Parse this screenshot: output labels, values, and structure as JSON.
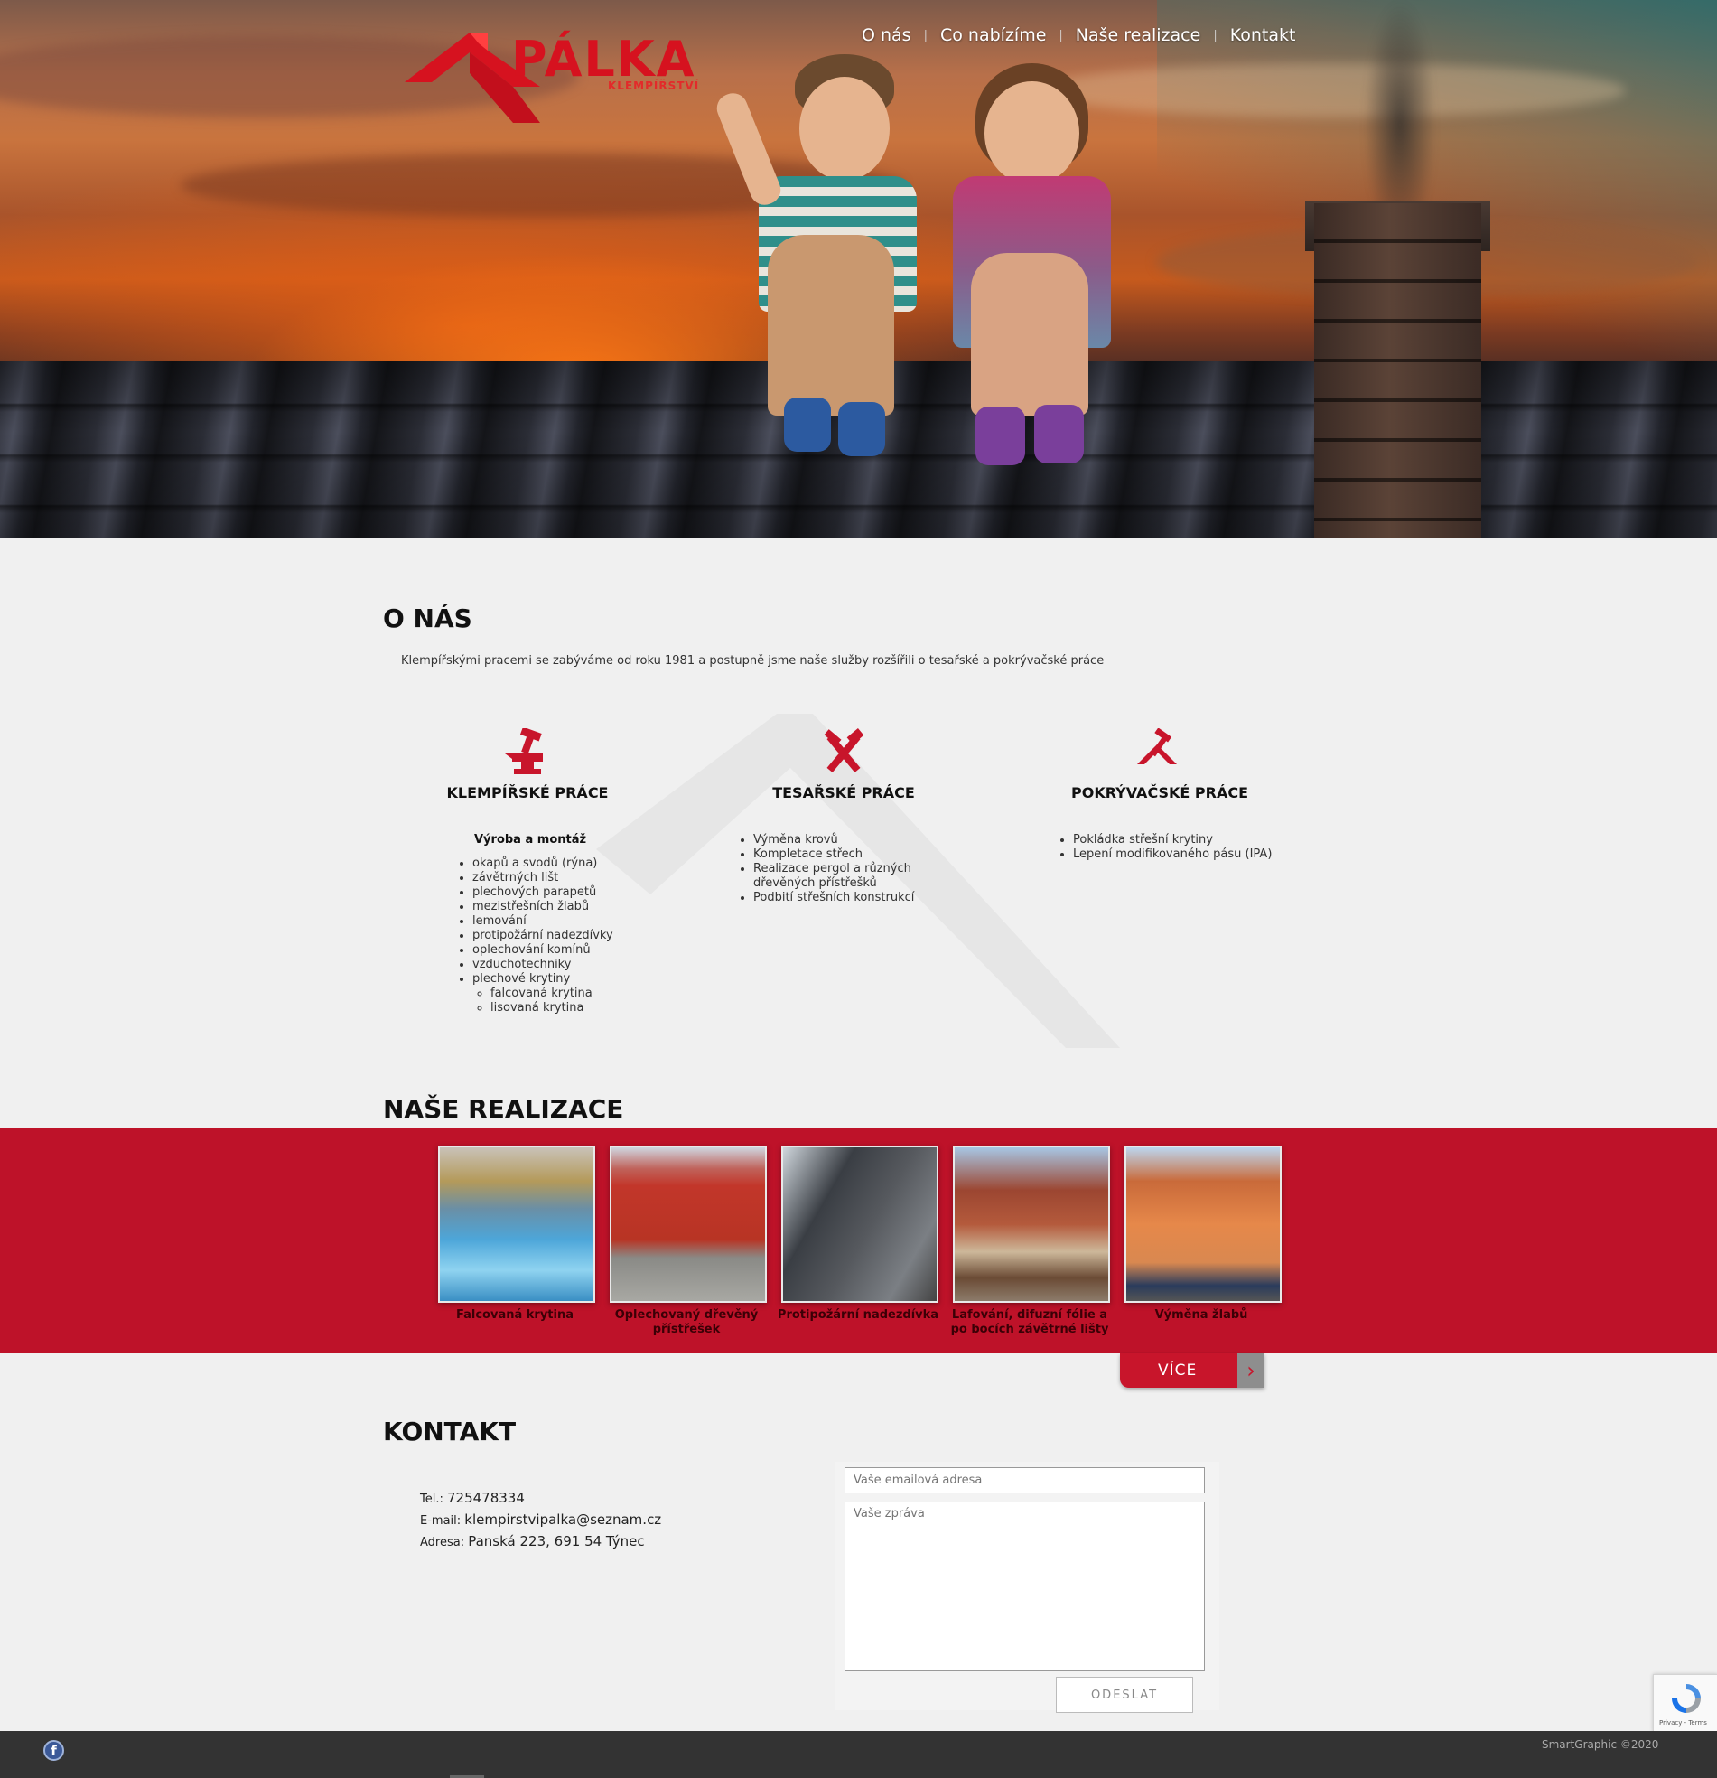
{
  "header": {
    "logo": {
      "brand": "PÁLKA",
      "sub": "KLEMPÍŘSTVÍ"
    },
    "nav": [
      {
        "label": "O nás"
      },
      {
        "label": "Co nabízíme"
      },
      {
        "label": "Naše realizace"
      },
      {
        "label": "Kontakt"
      }
    ]
  },
  "about": {
    "title": "O NÁS",
    "intro": "Klempířskými pracemi se zabýváme od roku 1981 a postupně jsme naše služby rozšířili o tesařské a pokrývačské práce",
    "services": [
      {
        "icon": "anvil-hammer-icon",
        "title": "KLEMPÍŘSKÉ PRÁCE",
        "subhead": "Výroba a montáž",
        "items": [
          "okapů a svodů (rýna)",
          "závětrných lišt",
          "plechových parapetů",
          "mezistřešních žlabů",
          "lemování",
          "protipožární nadezdívky",
          "oplechování komínů",
          "vzduchotechniky",
          "plechové krytiny"
        ],
        "subitems": [
          "falcovaná krytina",
          "lisovaná krytina"
        ]
      },
      {
        "icon": "crossed-tools-icon",
        "title": "TESAŘSKÉ PRÁCE",
        "items": [
          "Výměna krovů",
          "Kompletace střech",
          "Realizace pergol a různých dřevěných přístřešků",
          "Podbití střešních konstrukcí"
        ]
      },
      {
        "icon": "roof-hammer-icon",
        "title": "POKRÝVAČSKÉ PRÁCE",
        "items": [
          "Pokládka střešní krytiny",
          "Lepení modifikovaného pásu (IPA)"
        ]
      }
    ]
  },
  "projects": {
    "title": "NAŠE REALIZACE",
    "items": [
      {
        "caption": "Falcovaná krytina"
      },
      {
        "caption": "Oplechovaný dřevěný přístřešek"
      },
      {
        "caption": "Protipožární nadezdívka"
      },
      {
        "caption": "Lafování, difuzní fólie a po bocích závětrné lišty"
      },
      {
        "caption": "Výměna žlabů"
      }
    ],
    "more_label": "VÍCE"
  },
  "contact": {
    "title": "KONTAKT",
    "phone_label": "Tel.:",
    "phone": "725478334",
    "email_label": "E-mail:",
    "email": "klempirstvipalka@seznam.cz",
    "address_label": "Adresa:",
    "address": "Panská 223, 691 54 Týnec",
    "form": {
      "email_placeholder": "Vaše emailová adresa",
      "message_placeholder": "Vaše zpráva",
      "submit_label": "ODESLAT"
    },
    "recaptcha_text": "Privacy - Terms"
  },
  "footer": {
    "facebook_icon": "facebook-icon",
    "copyright": "SmartGraphic ©2020"
  },
  "colors": {
    "brand_red": "#be1229",
    "footer": "#333333",
    "background": "#f0f0f0"
  }
}
